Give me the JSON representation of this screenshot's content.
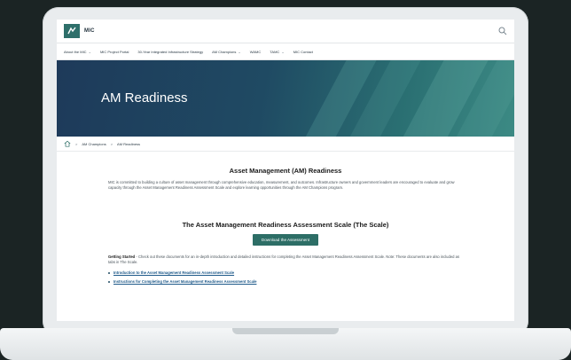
{
  "site": {
    "name": "MIC"
  },
  "nav": {
    "items": [
      {
        "label": "About the MIC",
        "has_dropdown": true
      },
      {
        "label": "MIC Project Portal",
        "has_dropdown": false
      },
      {
        "label": "30-Year Integrated Infrastructure Strategy",
        "has_dropdown": false
      },
      {
        "label": "AM Champions",
        "has_dropdown": true
      },
      {
        "label": "WAMC",
        "has_dropdown": false
      },
      {
        "label": "TAMC",
        "has_dropdown": true
      },
      {
        "label": "MIC Contact",
        "has_dropdown": false
      }
    ],
    "chevron": "⌄"
  },
  "hero": {
    "title": "AM Readiness"
  },
  "breadcrumb": {
    "separator": ">",
    "items": [
      "AM Champions",
      "AM Readiness"
    ]
  },
  "main": {
    "heading": "Asset Management (AM) Readiness",
    "intro": "MIC is committed to building a culture of asset management through comprehensive education, measurement, and outcomes. Infrastructure owners and government leaders are encouraged to evaluate and grow capacity through the Asset Management Readiness Assessment Scale and explore learning opportunities through the AM Champions program.",
    "scale_heading": "The Asset Management Readiness Assessment Scale (The Scale)",
    "download_button": "Download the Assessment",
    "getting_started_label": "Getting Started",
    "getting_started_text": " - Check out these documents for an in-depth introduction and detailed instructions for completing the Asset Management Readiness Assessment Scale. Note: These documents are also included as tabs in The Scale.",
    "documents": [
      "Introduction to the Asset Management Readiness Assessment Scale",
      "Instructions for Completing the Asset Management Readiness Assessment Scale"
    ]
  },
  "colors": {
    "page_background": "#1b2424",
    "hero_start": "#1e3a5a",
    "hero_end": "#3c8a84",
    "button": "#2d6e66",
    "link": "#1f5a8a"
  }
}
